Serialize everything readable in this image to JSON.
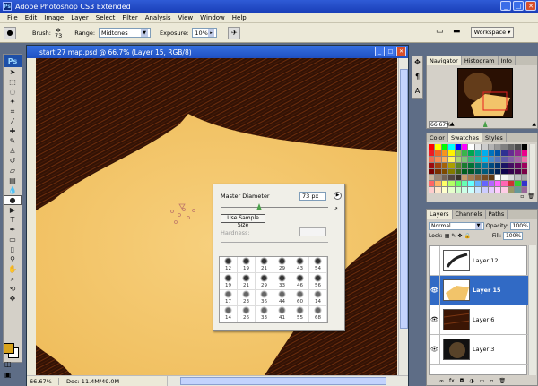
{
  "app": {
    "title": "Adobe Photoshop CS3 Extended",
    "logo": "Ps"
  },
  "menu": [
    "File",
    "Edit",
    "Image",
    "Layer",
    "Select",
    "Filter",
    "Analysis",
    "View",
    "Window",
    "Help"
  ],
  "options": {
    "brush_label": "Brush:",
    "brush_size": "73",
    "range_label": "Range:",
    "range_value": "Midtones",
    "exposure_label": "Exposure:",
    "exposure_value": "10%",
    "workspace_label": "Workspace ▾"
  },
  "document": {
    "title": "start 27 map.psd @ 66.7% (Layer 15, RGB/8)",
    "zoom": "66.67%",
    "doc_info": "Doc: 11.4M/49.0M"
  },
  "brush_picker": {
    "master_diameter_label": "Master Diameter",
    "diameter_value": "73 px",
    "use_sample_size_label": "Use Sample Size",
    "hardness_label": "Hardness:",
    "brushes": [
      [
        12,
        19,
        21,
        29,
        43,
        54
      ],
      [
        19,
        21,
        29,
        33,
        46,
        56
      ],
      [
        17,
        23,
        36,
        44,
        60,
        14
      ],
      [
        14,
        26,
        33,
        41,
        55,
        68
      ]
    ]
  },
  "navigator": {
    "tabs": [
      "Navigator",
      "Histogram",
      "Info"
    ],
    "zoom": "66.67%"
  },
  "swatches": {
    "tabs": [
      "Color",
      "Swatches",
      "Styles"
    ],
    "colors": [
      "#ff0000",
      "#ffff00",
      "#00ff00",
      "#00ffff",
      "#0000ff",
      "#ff00ff",
      "#ffffff",
      "#e6e6e6",
      "#cccccc",
      "#b3b3b3",
      "#999999",
      "#808080",
      "#666666",
      "#4d4d4d",
      "#000000",
      "#ed1c24",
      "#f26522",
      "#f7941d",
      "#fff200",
      "#8dc63f",
      "#39b54a",
      "#00a651",
      "#00a99d",
      "#00aeef",
      "#0072bc",
      "#0054a6",
      "#2e3192",
      "#662d91",
      "#92278f",
      "#ec008c",
      "#f26c4f",
      "#f68e56",
      "#fbaf5d",
      "#fff568",
      "#acd373",
      "#7cc576",
      "#3cb878",
      "#1cbbb4",
      "#00bff3",
      "#448ccb",
      "#5574b9",
      "#605ca8",
      "#8560a8",
      "#a864a8",
      "#f06eaa",
      "#9e0b0f",
      "#a0410d",
      "#a36209",
      "#aba000",
      "#598527",
      "#197b30",
      "#007236",
      "#00746b",
      "#0076a3",
      "#004a80",
      "#003471",
      "#1b1464",
      "#440e62",
      "#630460",
      "#9e005d",
      "#790000",
      "#7b2e00",
      "#7d4900",
      "#827b00",
      "#406618",
      "#005e20",
      "#005826",
      "#005952",
      "#005b7f",
      "#003663",
      "#002157",
      "#0d004c",
      "#32004b",
      "#4b0049",
      "#7b0046",
      "#c7b299",
      "#998675",
      "#736357",
      "#534741",
      "#37302a",
      "#c69c6d",
      "#a67c52",
      "#8c6239",
      "#754c24",
      "#603913",
      "#ffffff",
      "#f2f2f2",
      "#d9d9d9",
      "#bfbfbf",
      "#a6a6a6",
      "#ff6666",
      "#ffb366",
      "#ffff66",
      "#b3ff66",
      "#66ff66",
      "#66ffb3",
      "#66ffff",
      "#66b3ff",
      "#6666ff",
      "#b366ff",
      "#ff66ff",
      "#ff66b3",
      "#cc3333",
      "#33cc33",
      "#3333cc",
      "#ffcccc",
      "#ffe6cc",
      "#ffffcc",
      "#e6ffcc",
      "#ccffcc",
      "#ccffe6",
      "#ccffff",
      "#cce6ff",
      "#ccccff",
      "#e6ccff",
      "#ffccff",
      "#ffcce6",
      "#999966",
      "#669999",
      "#996699"
    ]
  },
  "layers_panel": {
    "tabs": [
      "Layers",
      "Channels",
      "Paths"
    ],
    "blend_mode": "Normal",
    "opacity_label": "Opacity:",
    "opacity_value": "100%",
    "lock_label": "Lock:",
    "fill_label": "Fill:",
    "fill_value": "100%",
    "layers": [
      {
        "name": "Layer 12",
        "visible": false,
        "selected": false
      },
      {
        "name": "Layer 15",
        "visible": true,
        "selected": true
      },
      {
        "name": "Layer 6",
        "visible": true,
        "selected": false
      },
      {
        "name": "Layer 3",
        "visible": true,
        "selected": false
      }
    ]
  },
  "colors": {
    "foreground": "#d8a31c",
    "background": "#ffffff",
    "parchment": "#f2c46a",
    "wood": "#3b1605"
  }
}
